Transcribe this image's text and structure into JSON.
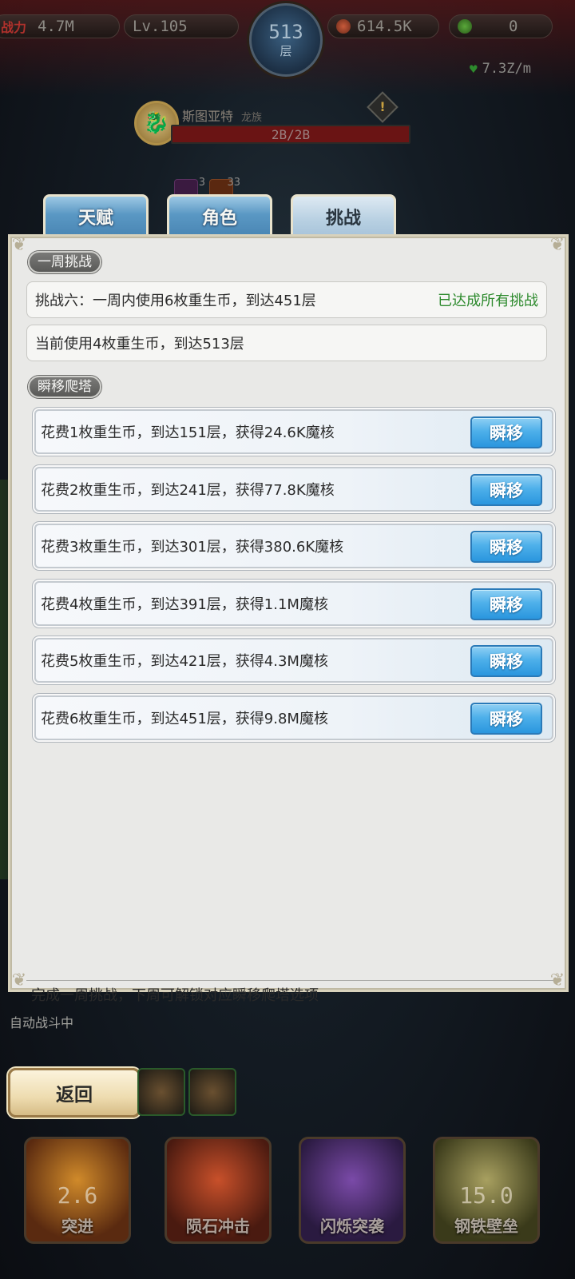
{
  "topbar": {
    "power_label": "战力",
    "power_value": "4.7M",
    "level": "Lv.105",
    "floor_number": "513",
    "floor_unit": "层",
    "currency_value": "614.5K",
    "gem_value": "0",
    "rate": "7.3Z/m"
  },
  "boss": {
    "name": "斯图亚特",
    "tag": "龙族",
    "hp": "2B/2B"
  },
  "buffs": [
    {
      "count": "3",
      "icon": "purple-buff-icon"
    },
    {
      "count": "33",
      "icon": "fire-buff-icon"
    }
  ],
  "tabs": [
    {
      "label": "天赋",
      "active": false
    },
    {
      "label": "角色",
      "active": false
    },
    {
      "label": "挑战",
      "active": true
    }
  ],
  "weekly": {
    "section_label": "一周挑战",
    "challenge_text": "挑战六：一周内使用6枚重生币，到达451层",
    "challenge_status": "已达成所有挑战",
    "current_text": "当前使用4枚重生币，到达513层"
  },
  "teleport": {
    "section_label": "瞬移爬塔",
    "button_label": "瞬移",
    "options": [
      {
        "text": "花费1枚重生币，到达151层，获得24.6K魔核"
      },
      {
        "text": "花费2枚重生币，到达241层，获得77.8K魔核"
      },
      {
        "text": "花费3枚重生币，到达301层，获得380.6K魔核"
      },
      {
        "text": "花费4枚重生币，到达391层，获得1.1M魔核"
      },
      {
        "text": "花费5枚重生币，到达421层，获得4.3M魔核"
      },
      {
        "text": "花费6枚重生币，到达451层，获得9.8M魔核"
      }
    ]
  },
  "footer_note": "完成一周挑战，下周可解锁对应瞬移爬塔选项",
  "bottom": {
    "auto_battle": "自动战斗中",
    "back_label": "返回",
    "skills": [
      {
        "name": "突进",
        "value": "2.6"
      },
      {
        "name": "陨石冲击",
        "value": ""
      },
      {
        "name": "闪烁突袭",
        "value": ""
      },
      {
        "name": "钢铁壁垒",
        "value": "15.0"
      }
    ]
  },
  "colors": {
    "accent_blue": "#2a96de",
    "success_green": "#2d8a2d",
    "boss_hp_red": "#6a1414"
  }
}
